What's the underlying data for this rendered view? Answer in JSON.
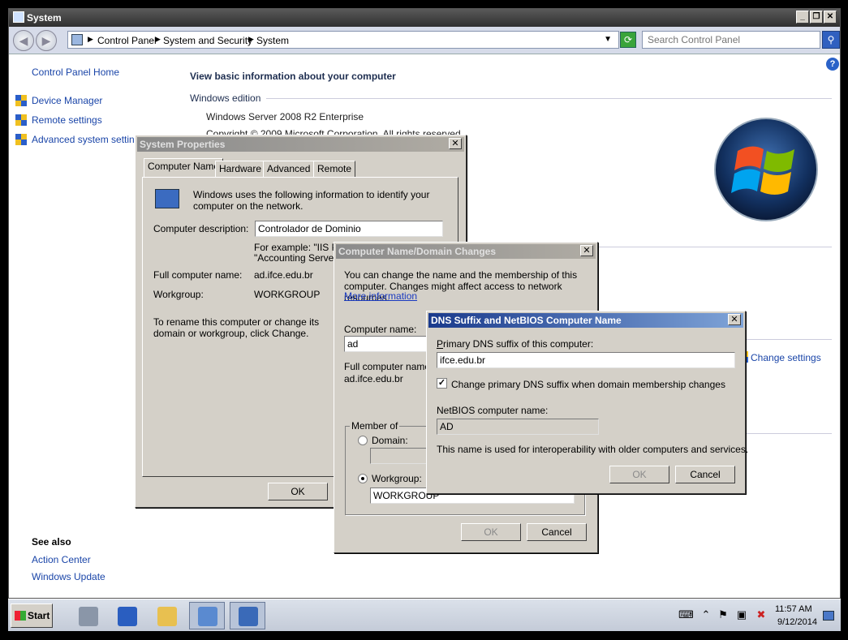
{
  "window": {
    "title": "System",
    "min": "_",
    "max": "❐",
    "close": "✕"
  },
  "address": {
    "crumbs": [
      "Control Panel",
      "System and Security",
      "System"
    ],
    "search_placeholder": "Search Control Panel"
  },
  "left_nav": {
    "home": "Control Panel Home",
    "items": [
      "Device Manager",
      "Remote settings",
      "Advanced system settings"
    ],
    "see_also_title": "See also",
    "see_also": [
      "Action Center",
      "Windows Update"
    ]
  },
  "main": {
    "title": "View basic information about your computer",
    "edition_heading": "Windows edition",
    "edition": "Windows Server 2008 R2 Enterprise",
    "copyright": "Copyright © 2009 Microsoft Corporation.  All rights reserved.",
    "change_settings": "Change settings"
  },
  "system_properties": {
    "title": "System Properties",
    "tabs": [
      "Computer Name",
      "Hardware",
      "Advanced",
      "Remote"
    ],
    "intro": "Windows uses the following information to identify your computer on the network.",
    "desc_label": "Computer description:",
    "desc_value": "Controlador de Dominio",
    "example_line1": "For example: \"IIS Pro",
    "example_line2": "\"Accounting Server\"",
    "full_name_label": "Full computer name:",
    "full_name_value": "ad.ifce.edu.br",
    "workgroup_label": "Workgroup:",
    "workgroup_value": "WORKGROUP",
    "rename_text": "To rename this computer or change its domain or workgroup, click Change.",
    "ok": "OK"
  },
  "name_changes": {
    "title": "Computer Name/Domain Changes",
    "intro": "You can change the name and the membership of this computer. Changes might affect access to network resources.",
    "more_info": "More information",
    "computer_name_label": "Computer name:",
    "computer_name_value": "ad",
    "full_name_label": "Full computer name:",
    "full_name_value": "ad.ifce.edu.br",
    "member_of": "Member of",
    "domain_label": "Domain:",
    "workgroup_label": "Workgroup:",
    "workgroup_value": "WORKGROUP",
    "ok": "OK",
    "cancel": "Cancel"
  },
  "dns_suffix": {
    "title": "DNS Suffix and NetBIOS Computer Name",
    "primary_label": "Primary DNS suffix of this computer:",
    "primary_value": "ifce.edu.br",
    "checkbox_label": "Change primary DNS suffix when domain membership changes",
    "netbios_label": "NetBIOS computer name:",
    "netbios_value": "AD",
    "note": "This name is used for interoperability with older computers and services.",
    "ok": "OK",
    "cancel": "Cancel"
  },
  "taskbar": {
    "start": "Start",
    "time": "11:57 AM",
    "date": "9/12/2014"
  }
}
